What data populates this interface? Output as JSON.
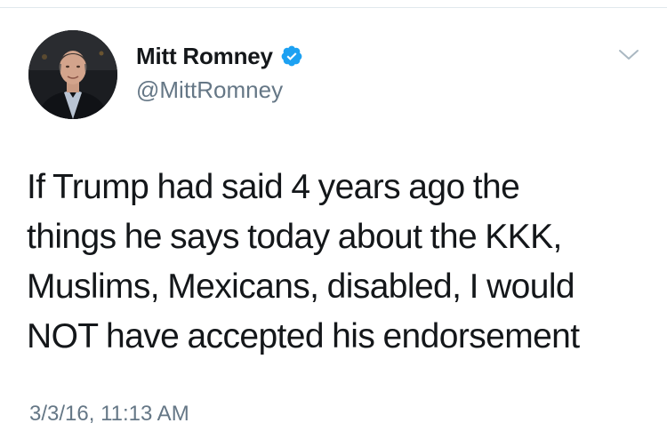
{
  "author": {
    "display_name": "Mitt Romney",
    "handle": "@MittRomney",
    "verified": true,
    "verified_badge_color": "#1da1f2"
  },
  "tweet": {
    "text_lines": [
      "If Trump had said 4 years ago the",
      "things he says today about the KKK,",
      "Muslims, Mexicans, disabled, I would",
      "NOT have accepted his endorsement"
    ],
    "timestamp": "3/3/16, 11:13 AM"
  },
  "icons": {
    "verified": "verified-badge-icon",
    "menu": "chevron-down-icon",
    "avatar": "profile-photo"
  },
  "colors": {
    "text": "#14171a",
    "secondary_text": "#657786",
    "border": "#e1e8ed"
  }
}
